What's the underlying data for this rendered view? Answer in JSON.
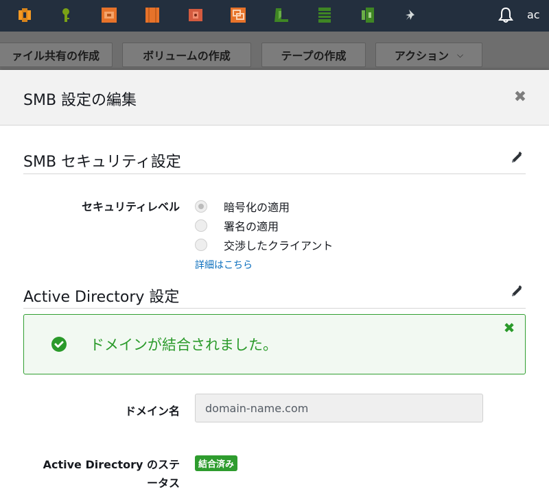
{
  "nav": {
    "services": [
      {
        "icon": "compute-service-icon",
        "color": "#f59a23"
      },
      {
        "icon": "key-service-icon",
        "color": "#7aa116"
      },
      {
        "icon": "api-service-icon",
        "color": "#e7732a"
      },
      {
        "icon": "ec2-service-icon",
        "color": "#e7732a"
      },
      {
        "icon": "lambda-service-icon",
        "color": "#d45b3f"
      },
      {
        "icon": "workspaces-service-icon",
        "color": "#e7732a"
      },
      {
        "icon": "s3-service-icon",
        "color": "#3f8624"
      },
      {
        "icon": "storage-gateway-service-icon",
        "color": "#3f8624"
      },
      {
        "icon": "backup-service-icon",
        "color": "#3f8624"
      },
      {
        "icon": "pin-icon",
        "color": "#d5dbdb"
      }
    ],
    "account_text": "ac"
  },
  "toolbar": {
    "file_share_label": "ァイル共有の作成",
    "volume_label": "ボリュームの作成",
    "tape_label": "テープの作成",
    "actions_label": "アクション",
    "actions_caret": "⌵"
  },
  "modal": {
    "title": "SMB 設定の編集",
    "close_glyph": "✖",
    "smb_security": {
      "title": "SMB セキュリティ設定",
      "level_label": "セキュリティレベル",
      "options": [
        {
          "label": "暗号化の適用",
          "selected": true
        },
        {
          "label": "署名の適用",
          "selected": false
        },
        {
          "label": "交渉したクライアント",
          "selected": false
        }
      ],
      "details_link": "詳細はこちら"
    },
    "active_directory": {
      "title": "Active Directory 設定",
      "alert_text": "ドメインが結合されました。",
      "alert_close_glyph": "✖",
      "domain_label": "ドメイン名",
      "domain_value": "domain-name.com",
      "status_label_line1": "Active Directory のステ",
      "status_label_line2": "ータス",
      "status_badge": "結合済み"
    }
  },
  "colors": {
    "nav_bg": "#232f3e",
    "success_green": "#2a9a2a",
    "link_blue": "#0a6ebd"
  }
}
